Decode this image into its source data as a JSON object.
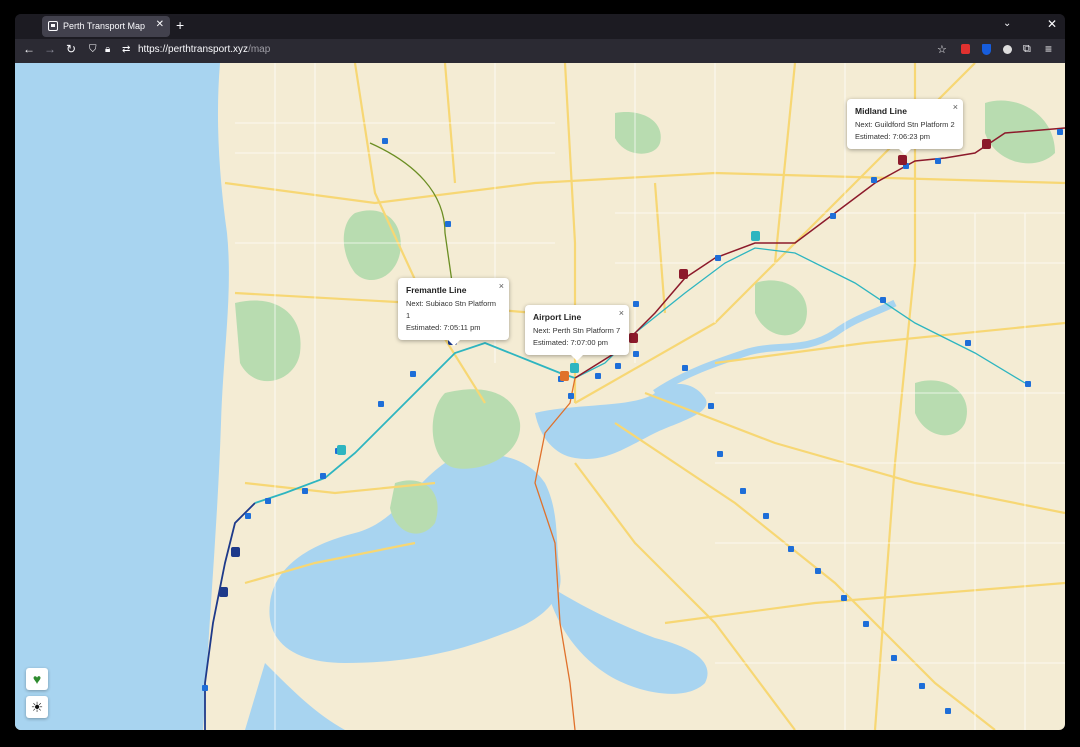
{
  "browser": {
    "tab_title": "Perth Transport Map",
    "url_host": "https://perthtransport.xyz",
    "url_path": "/map",
    "icons": [
      "back-icon",
      "forward-icon",
      "reload-icon",
      "shield-icon",
      "lock-icon",
      "tracking-icon",
      "bookmark-star-icon",
      "extension-icon",
      "bitwarden-icon",
      "ublock-icon",
      "extensions-icon",
      "menu-icon"
    ]
  },
  "popups": [
    {
      "line": "Fremantle Line",
      "next": "Next: Subiaco Stn Platform 1",
      "eta": "Estimated: 7:05:11 pm"
    },
    {
      "line": "Airport Line",
      "next": "Next: Perth Stn Platform 7",
      "eta": "Estimated: 7:07:00 pm"
    },
    {
      "line": "Midland Line",
      "next": "Next: Guildford Stn Platform 2",
      "eta": "Estimated: 7:06:23 pm"
    }
  ],
  "colors": {
    "ocean": "#a8d4f0",
    "land": "#f4ecd4",
    "park": "#b8dcb0",
    "road": "#f7d774",
    "fremantle_line": "#2eb5c0",
    "airport_line": "#2eb5c0",
    "midland_line": "#8c1a2b",
    "joondalup_line": "#1e3a8a",
    "station_icon": "#1e6ed8"
  },
  "controls": {
    "favorite": "heart-icon",
    "theme": "sun-icon"
  }
}
